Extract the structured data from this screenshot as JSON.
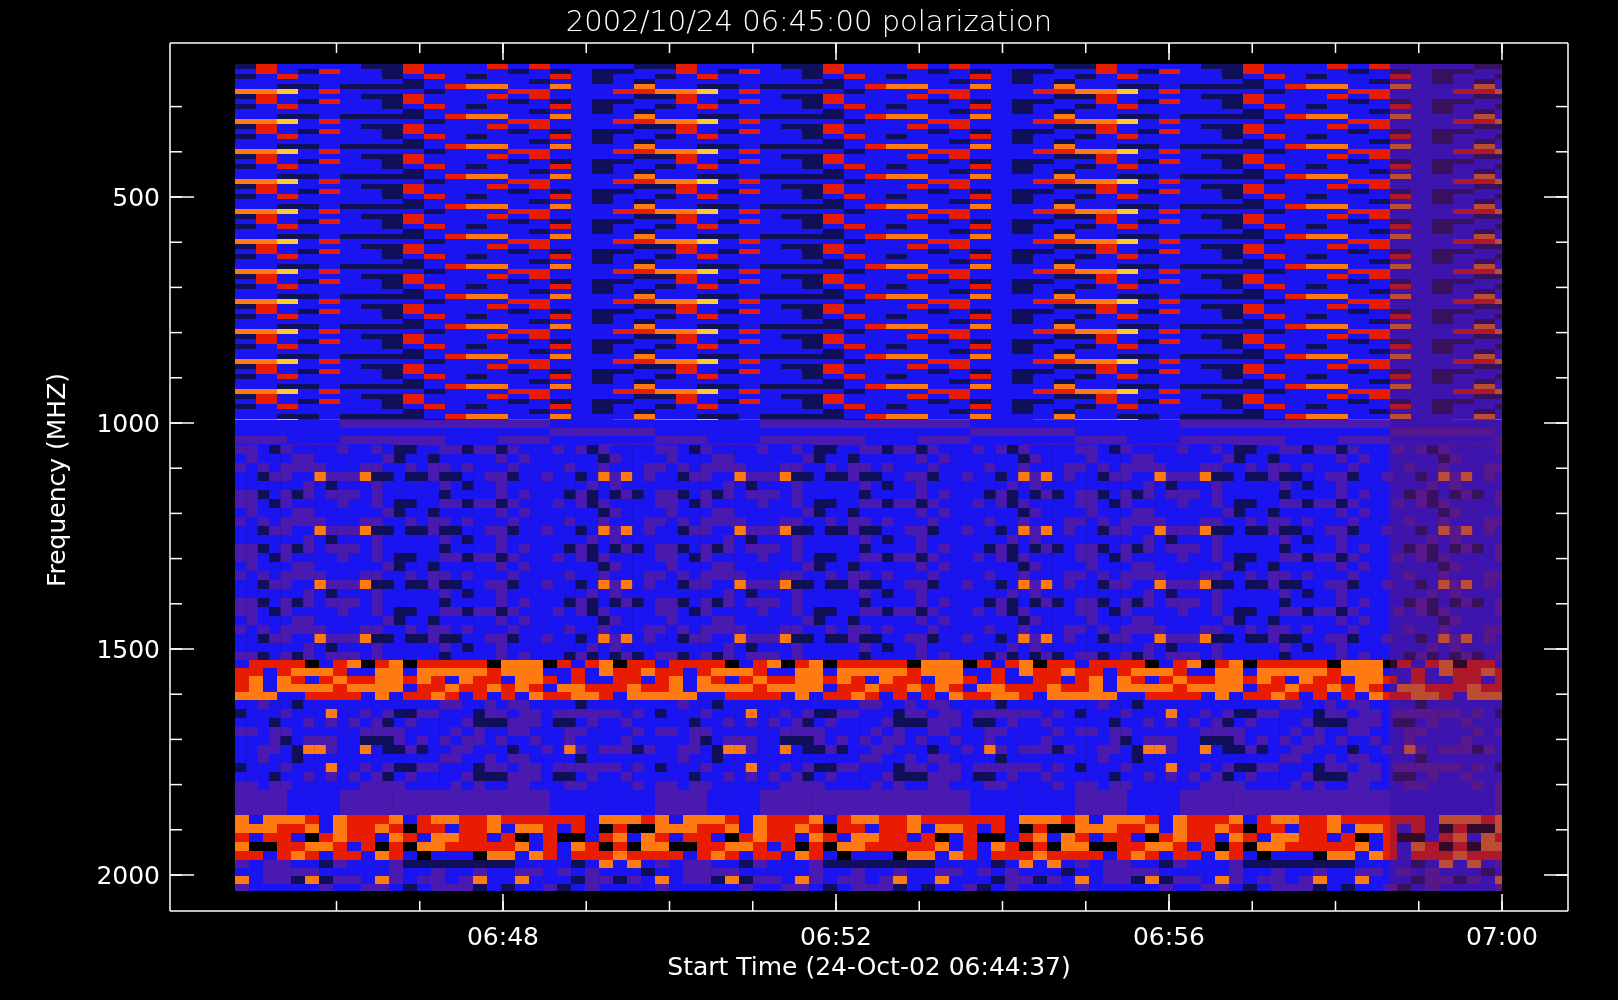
{
  "title": "2002/10/24 06:45:00 polarization",
  "x_axis": {
    "label": "Start Time (24-Oct-02 06:44:37)",
    "ticks": [
      "06:48",
      "06:52",
      "06:56",
      "07:00"
    ]
  },
  "y_axis": {
    "label": "Frequency (MHZ)",
    "ticks": [
      "500",
      "1000",
      "1500",
      "2000"
    ]
  }
}
